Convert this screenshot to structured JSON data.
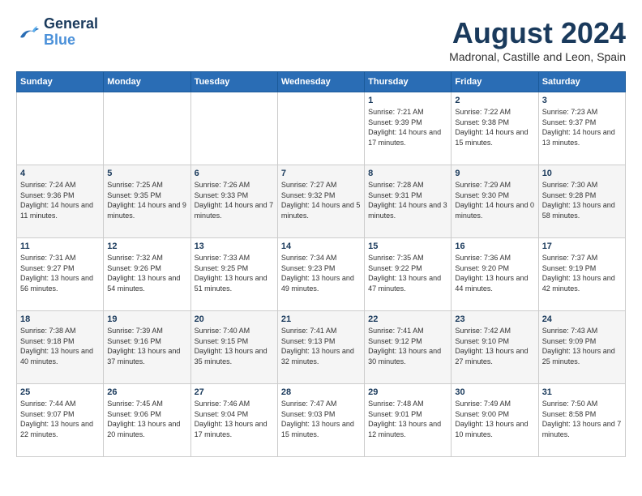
{
  "logo": {
    "line1": "General",
    "line2": "Blue"
  },
  "title": "August 2024",
  "location": "Madronal, Castille and Leon, Spain",
  "weekdays": [
    "Sunday",
    "Monday",
    "Tuesday",
    "Wednesday",
    "Thursday",
    "Friday",
    "Saturday"
  ],
  "weeks": [
    [
      {
        "day": "",
        "sunrise": "",
        "sunset": "",
        "daylight": ""
      },
      {
        "day": "",
        "sunrise": "",
        "sunset": "",
        "daylight": ""
      },
      {
        "day": "",
        "sunrise": "",
        "sunset": "",
        "daylight": ""
      },
      {
        "day": "",
        "sunrise": "",
        "sunset": "",
        "daylight": ""
      },
      {
        "day": "1",
        "sunrise": "Sunrise: 7:21 AM",
        "sunset": "Sunset: 9:39 PM",
        "daylight": "Daylight: 14 hours and 17 minutes."
      },
      {
        "day": "2",
        "sunrise": "Sunrise: 7:22 AM",
        "sunset": "Sunset: 9:38 PM",
        "daylight": "Daylight: 14 hours and 15 minutes."
      },
      {
        "day": "3",
        "sunrise": "Sunrise: 7:23 AM",
        "sunset": "Sunset: 9:37 PM",
        "daylight": "Daylight: 14 hours and 13 minutes."
      }
    ],
    [
      {
        "day": "4",
        "sunrise": "Sunrise: 7:24 AM",
        "sunset": "Sunset: 9:36 PM",
        "daylight": "Daylight: 14 hours and 11 minutes."
      },
      {
        "day": "5",
        "sunrise": "Sunrise: 7:25 AM",
        "sunset": "Sunset: 9:35 PM",
        "daylight": "Daylight: 14 hours and 9 minutes."
      },
      {
        "day": "6",
        "sunrise": "Sunrise: 7:26 AM",
        "sunset": "Sunset: 9:33 PM",
        "daylight": "Daylight: 14 hours and 7 minutes."
      },
      {
        "day": "7",
        "sunrise": "Sunrise: 7:27 AM",
        "sunset": "Sunset: 9:32 PM",
        "daylight": "Daylight: 14 hours and 5 minutes."
      },
      {
        "day": "8",
        "sunrise": "Sunrise: 7:28 AM",
        "sunset": "Sunset: 9:31 PM",
        "daylight": "Daylight: 14 hours and 3 minutes."
      },
      {
        "day": "9",
        "sunrise": "Sunrise: 7:29 AM",
        "sunset": "Sunset: 9:30 PM",
        "daylight": "Daylight: 14 hours and 0 minutes."
      },
      {
        "day": "10",
        "sunrise": "Sunrise: 7:30 AM",
        "sunset": "Sunset: 9:28 PM",
        "daylight": "Daylight: 13 hours and 58 minutes."
      }
    ],
    [
      {
        "day": "11",
        "sunrise": "Sunrise: 7:31 AM",
        "sunset": "Sunset: 9:27 PM",
        "daylight": "Daylight: 13 hours and 56 minutes."
      },
      {
        "day": "12",
        "sunrise": "Sunrise: 7:32 AM",
        "sunset": "Sunset: 9:26 PM",
        "daylight": "Daylight: 13 hours and 54 minutes."
      },
      {
        "day": "13",
        "sunrise": "Sunrise: 7:33 AM",
        "sunset": "Sunset: 9:25 PM",
        "daylight": "Daylight: 13 hours and 51 minutes."
      },
      {
        "day": "14",
        "sunrise": "Sunrise: 7:34 AM",
        "sunset": "Sunset: 9:23 PM",
        "daylight": "Daylight: 13 hours and 49 minutes."
      },
      {
        "day": "15",
        "sunrise": "Sunrise: 7:35 AM",
        "sunset": "Sunset: 9:22 PM",
        "daylight": "Daylight: 13 hours and 47 minutes."
      },
      {
        "day": "16",
        "sunrise": "Sunrise: 7:36 AM",
        "sunset": "Sunset: 9:20 PM",
        "daylight": "Daylight: 13 hours and 44 minutes."
      },
      {
        "day": "17",
        "sunrise": "Sunrise: 7:37 AM",
        "sunset": "Sunset: 9:19 PM",
        "daylight": "Daylight: 13 hours and 42 minutes."
      }
    ],
    [
      {
        "day": "18",
        "sunrise": "Sunrise: 7:38 AM",
        "sunset": "Sunset: 9:18 PM",
        "daylight": "Daylight: 13 hours and 40 minutes."
      },
      {
        "day": "19",
        "sunrise": "Sunrise: 7:39 AM",
        "sunset": "Sunset: 9:16 PM",
        "daylight": "Daylight: 13 hours and 37 minutes."
      },
      {
        "day": "20",
        "sunrise": "Sunrise: 7:40 AM",
        "sunset": "Sunset: 9:15 PM",
        "daylight": "Daylight: 13 hours and 35 minutes."
      },
      {
        "day": "21",
        "sunrise": "Sunrise: 7:41 AM",
        "sunset": "Sunset: 9:13 PM",
        "daylight": "Daylight: 13 hours and 32 minutes."
      },
      {
        "day": "22",
        "sunrise": "Sunrise: 7:41 AM",
        "sunset": "Sunset: 9:12 PM",
        "daylight": "Daylight: 13 hours and 30 minutes."
      },
      {
        "day": "23",
        "sunrise": "Sunrise: 7:42 AM",
        "sunset": "Sunset: 9:10 PM",
        "daylight": "Daylight: 13 hours and 27 minutes."
      },
      {
        "day": "24",
        "sunrise": "Sunrise: 7:43 AM",
        "sunset": "Sunset: 9:09 PM",
        "daylight": "Daylight: 13 hours and 25 minutes."
      }
    ],
    [
      {
        "day": "25",
        "sunrise": "Sunrise: 7:44 AM",
        "sunset": "Sunset: 9:07 PM",
        "daylight": "Daylight: 13 hours and 22 minutes."
      },
      {
        "day": "26",
        "sunrise": "Sunrise: 7:45 AM",
        "sunset": "Sunset: 9:06 PM",
        "daylight": "Daylight: 13 hours and 20 minutes."
      },
      {
        "day": "27",
        "sunrise": "Sunrise: 7:46 AM",
        "sunset": "Sunset: 9:04 PM",
        "daylight": "Daylight: 13 hours and 17 minutes."
      },
      {
        "day": "28",
        "sunrise": "Sunrise: 7:47 AM",
        "sunset": "Sunset: 9:03 PM",
        "daylight": "Daylight: 13 hours and 15 minutes."
      },
      {
        "day": "29",
        "sunrise": "Sunrise: 7:48 AM",
        "sunset": "Sunset: 9:01 PM",
        "daylight": "Daylight: 13 hours and 12 minutes."
      },
      {
        "day": "30",
        "sunrise": "Sunrise: 7:49 AM",
        "sunset": "Sunset: 9:00 PM",
        "daylight": "Daylight: 13 hours and 10 minutes."
      },
      {
        "day": "31",
        "sunrise": "Sunrise: 7:50 AM",
        "sunset": "Sunset: 8:58 PM",
        "daylight": "Daylight: 13 hours and 7 minutes."
      }
    ]
  ]
}
